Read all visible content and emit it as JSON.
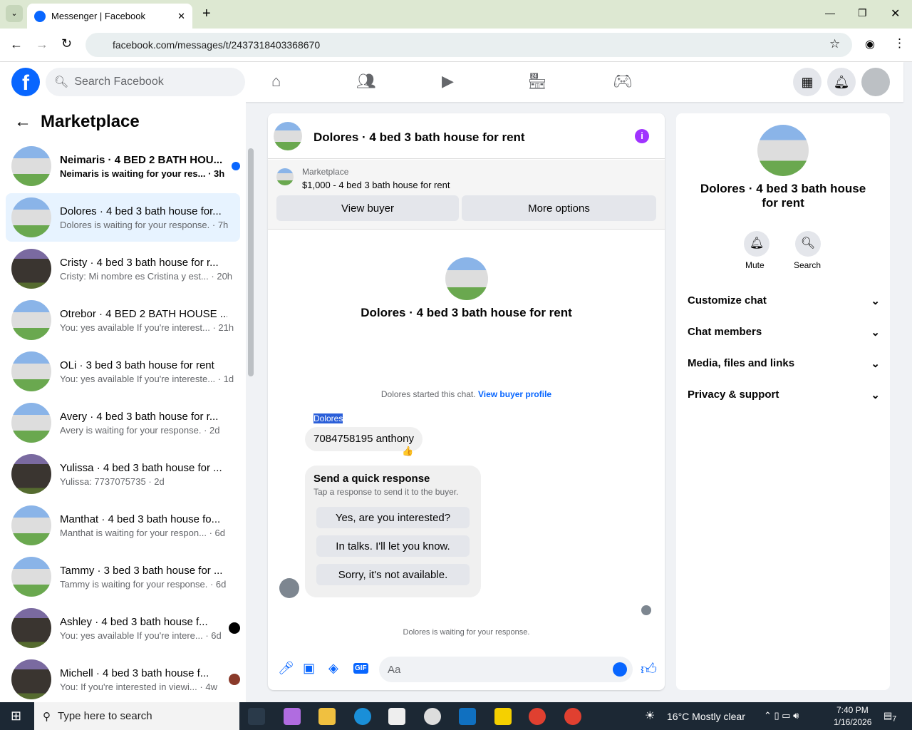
{
  "browser": {
    "tab_title": "Messenger | Facebook",
    "url": "facebook.com/messages/t/2437318403368670"
  },
  "header": {
    "search_placeholder": "Search Facebook"
  },
  "sidebar": {
    "title": "Marketplace",
    "conversations": [
      {
        "name": "Neimaris · 4 BED 2 BATH HOU...",
        "snippet": "Neimaris is waiting for your res...",
        "time": "· 3h",
        "unread": true
      },
      {
        "name": "Dolores · 4 bed 3 bath house for...",
        "snippet": "Dolores is waiting for your response.",
        "time": "· 7h",
        "selected": true
      },
      {
        "name": "Cristy · 4 bed 3 bath house for r...",
        "snippet": "Cristy: Mi nombre es Cristina y est...",
        "time": "· 20h"
      },
      {
        "name": "Otrebor · 4 BED 2 BATH HOUSE ...",
        "snippet": "You: yes available If you're interest...",
        "time": "· 21h"
      },
      {
        "name": "OLi · 3 bed 3 bath house for rent",
        "snippet": "You: yes available If you're intereste...",
        "time": "· 1d"
      },
      {
        "name": "Avery · 4 bed 3 bath house for r...",
        "snippet": "Avery is waiting for your response.",
        "time": "· 2d"
      },
      {
        "name": "Yulissa · 4 bed 3 bath house for ...",
        "snippet": "Yulissa: 7737075735",
        "time": "· 2d"
      },
      {
        "name": "Manthat · 4 bed 3 bath house fo...",
        "snippet": "Manthat is waiting for your respon...",
        "time": "· 6d"
      },
      {
        "name": "Tammy · 3 bed 3 bath house for ...",
        "snippet": "Tammy is waiting for your response.",
        "time": "· 6d"
      },
      {
        "name": "Ashley · 4 bed 3 bath house f...",
        "snippet": "You: yes available If you're intere...",
        "time": "· 6d"
      },
      {
        "name": "Michell · 4 bed 3 bath house f...",
        "snippet": "You: If you're interested in viewi...",
        "time": "· 4w"
      }
    ]
  },
  "chat": {
    "title": "Dolores · 4 bed 3 bath house for rent",
    "listing_label": "Marketplace",
    "listing_detail": "$1,000 - 4 bed 3 bath house for rent",
    "view_buyer": "View buyer",
    "more_options": "More options",
    "profile_name": "Dolores · 4 bed 3 bath house for rent",
    "started": "Dolores started this chat.",
    "view_profile": "View buyer profile",
    "sender": "Dolores",
    "message": "7084758195 anthony",
    "reaction": "👍",
    "quick_title": "Send a quick response",
    "quick_sub": "Tap a response to send it to the buyer.",
    "quick_responses": [
      "Yes, are you interested?",
      "In talks. I'll let you know.",
      "Sorry, it's not available."
    ],
    "waiting": "Dolores is waiting for your response.",
    "input_placeholder": "Aa"
  },
  "details": {
    "name": "Dolores · 4 bed 3 bath house for rent",
    "mute": "Mute",
    "search": "Search",
    "sections": [
      "Customize chat",
      "Chat members",
      "Media, files and links",
      "Privacy & support"
    ]
  },
  "taskbar": {
    "search_placeholder": "Type here to search",
    "weather": "16°C  Mostly clear",
    "time": "7:40 PM",
    "date": "1/16/2026",
    "notifications": "7"
  },
  "colors": {
    "accent": "#0866ff",
    "info": "#a033ff"
  }
}
